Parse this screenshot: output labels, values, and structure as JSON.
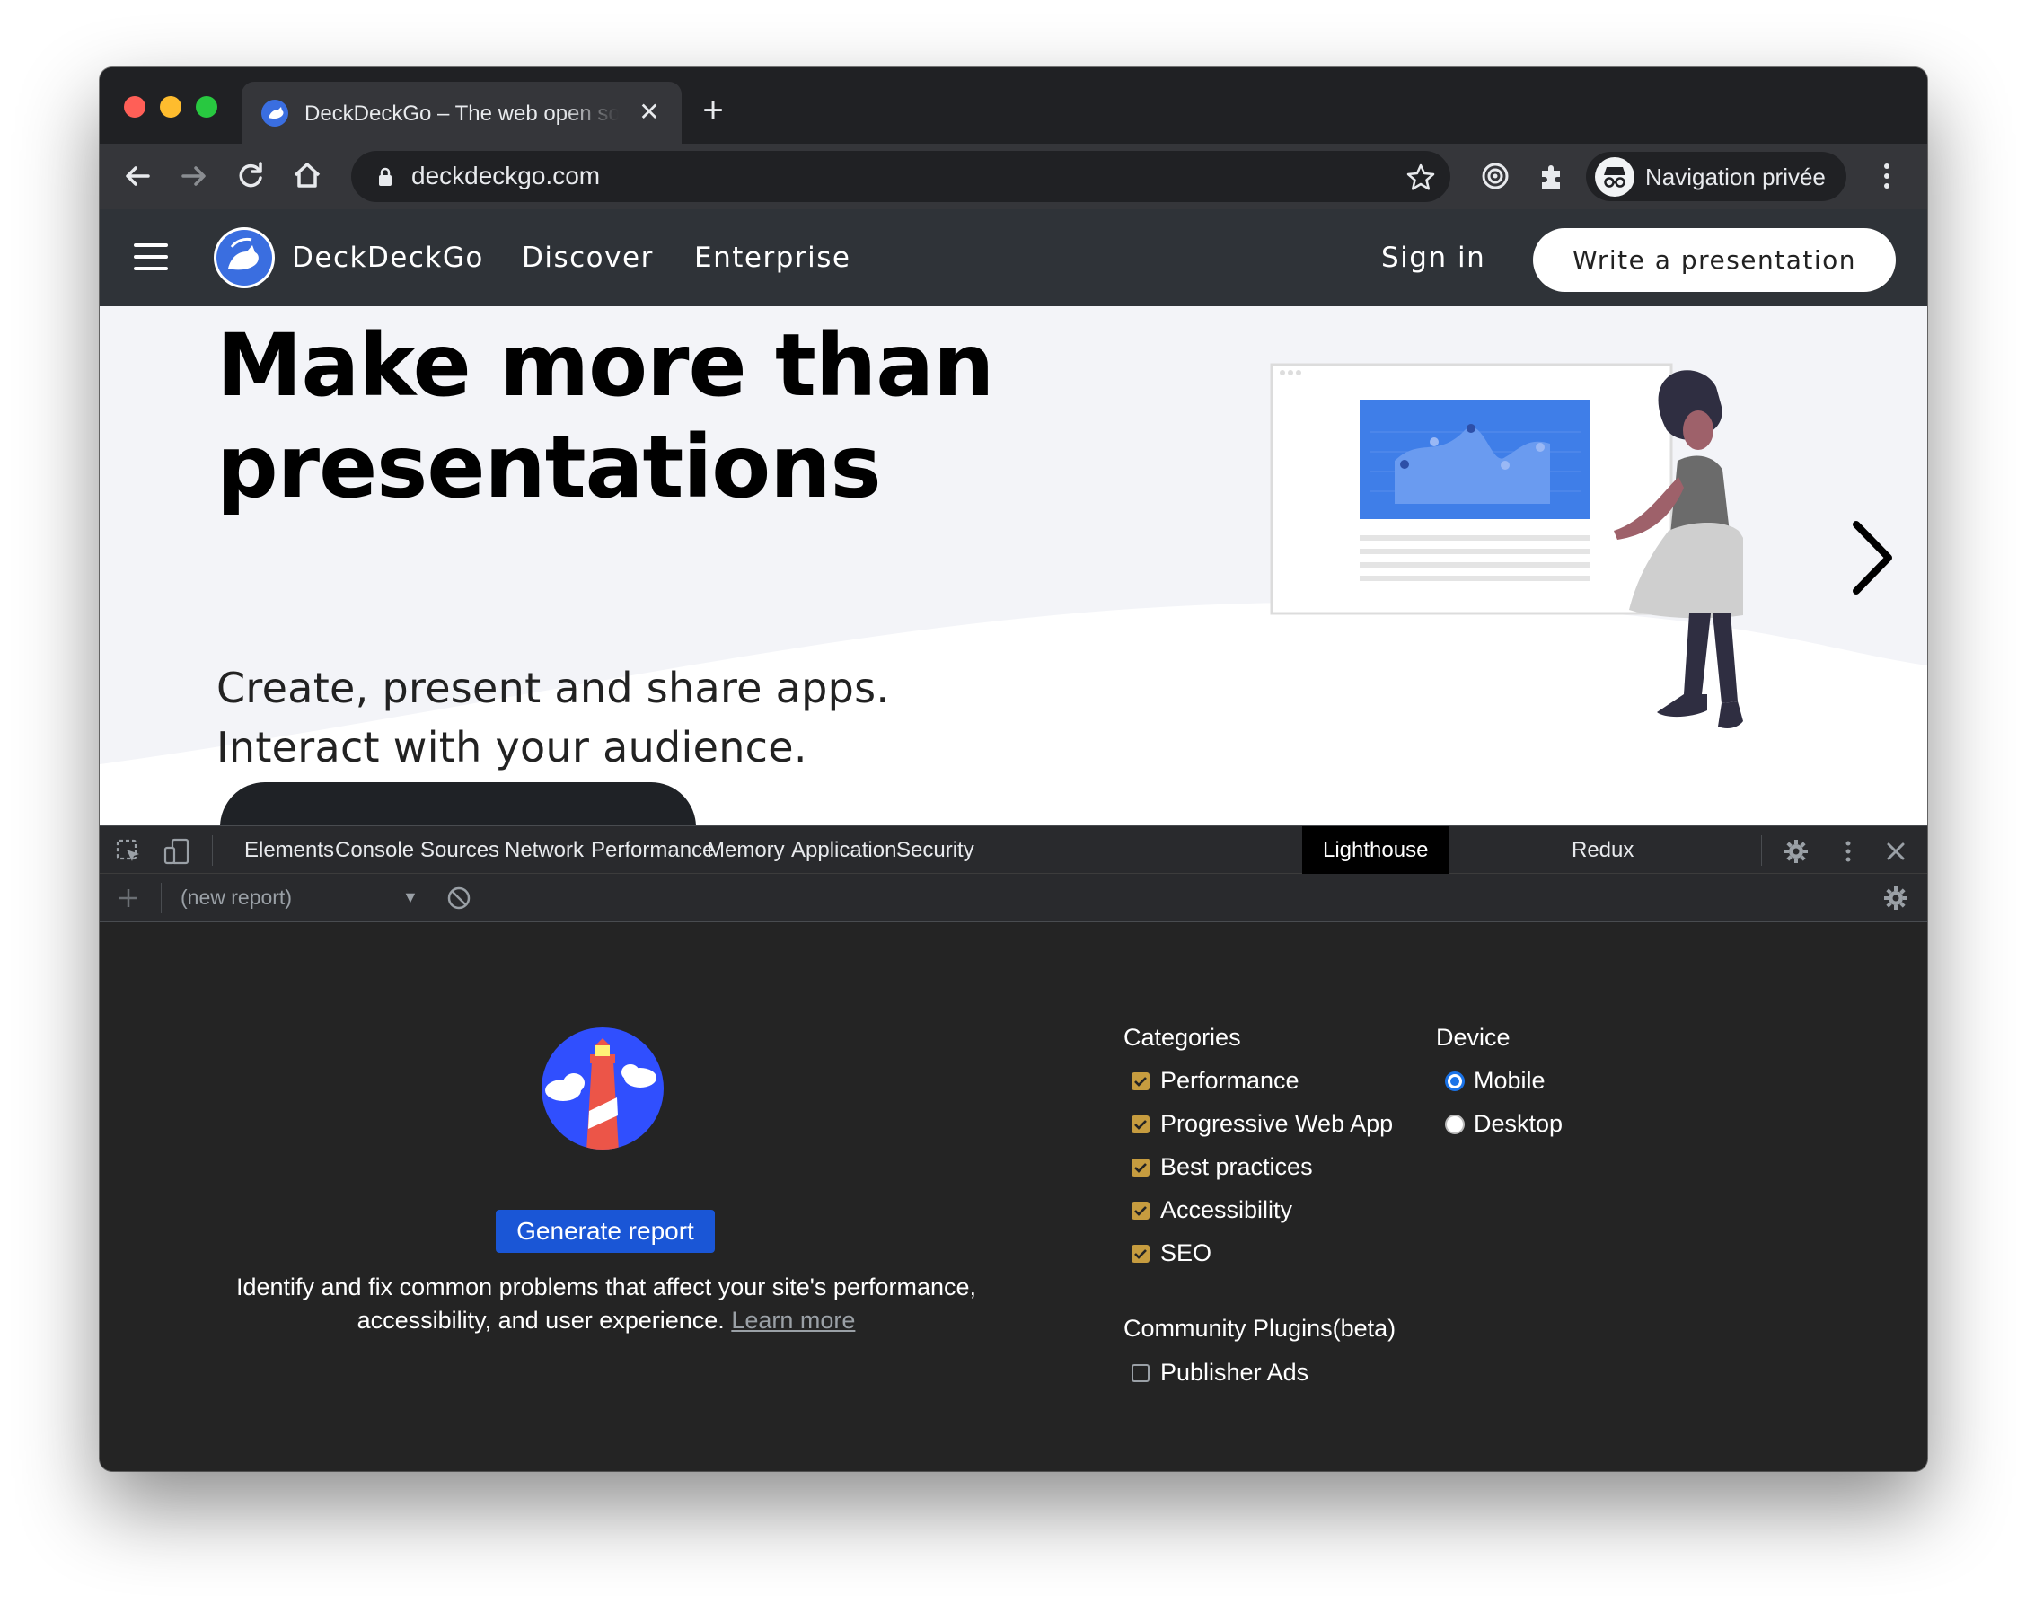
{
  "browser": {
    "tab_title": "DeckDeckGo – The web open source editor for presentations",
    "tab_close_glyph": "✕",
    "new_tab_glyph": "+",
    "url": "deckdeckgo.com",
    "profile_label": "Navigation privée"
  },
  "site": {
    "brand": "DeckDeckGo",
    "nav": [
      "Discover",
      "Enterprise"
    ],
    "sign_in": "Sign in",
    "cta": "Write a presentation",
    "hero_title": "Make more than presentations",
    "hero_subtitle_line1": "Create, present and share apps.",
    "hero_subtitle_line2": "Interact with your audience."
  },
  "devtools": {
    "tabs": [
      "Elements",
      "Console",
      "Sources",
      "Network",
      "Performance",
      "Memory",
      "Application",
      "Security",
      "Lighthouse",
      "Redux"
    ],
    "active_tab": "Lighthouse",
    "report_select": "(new report)",
    "lighthouse": {
      "generate_label": "Generate report",
      "description": "Identify and fix common problems that affect your site's performance, accessibility, and user experience.",
      "learn_more": "Learn more",
      "categories_title": "Categories",
      "categories": [
        {
          "label": "Performance",
          "checked": true
        },
        {
          "label": "Progressive Web App",
          "checked": true
        },
        {
          "label": "Best practices",
          "checked": true
        },
        {
          "label": "Accessibility",
          "checked": true
        },
        {
          "label": "SEO",
          "checked": true
        }
      ],
      "device_title": "Device",
      "devices": [
        {
          "label": "Mobile",
          "selected": true
        },
        {
          "label": "Desktop",
          "selected": false
        }
      ],
      "plugins_title": "Community Plugins(beta)",
      "plugins": [
        {
          "label": "Publisher Ads",
          "checked": false
        }
      ]
    }
  },
  "colors": {
    "accent_blue": "#1a56d6",
    "checkbox_gold": "#c69c3f",
    "devtools_bg": "#242424",
    "site_nav_bg": "#2f3338"
  }
}
